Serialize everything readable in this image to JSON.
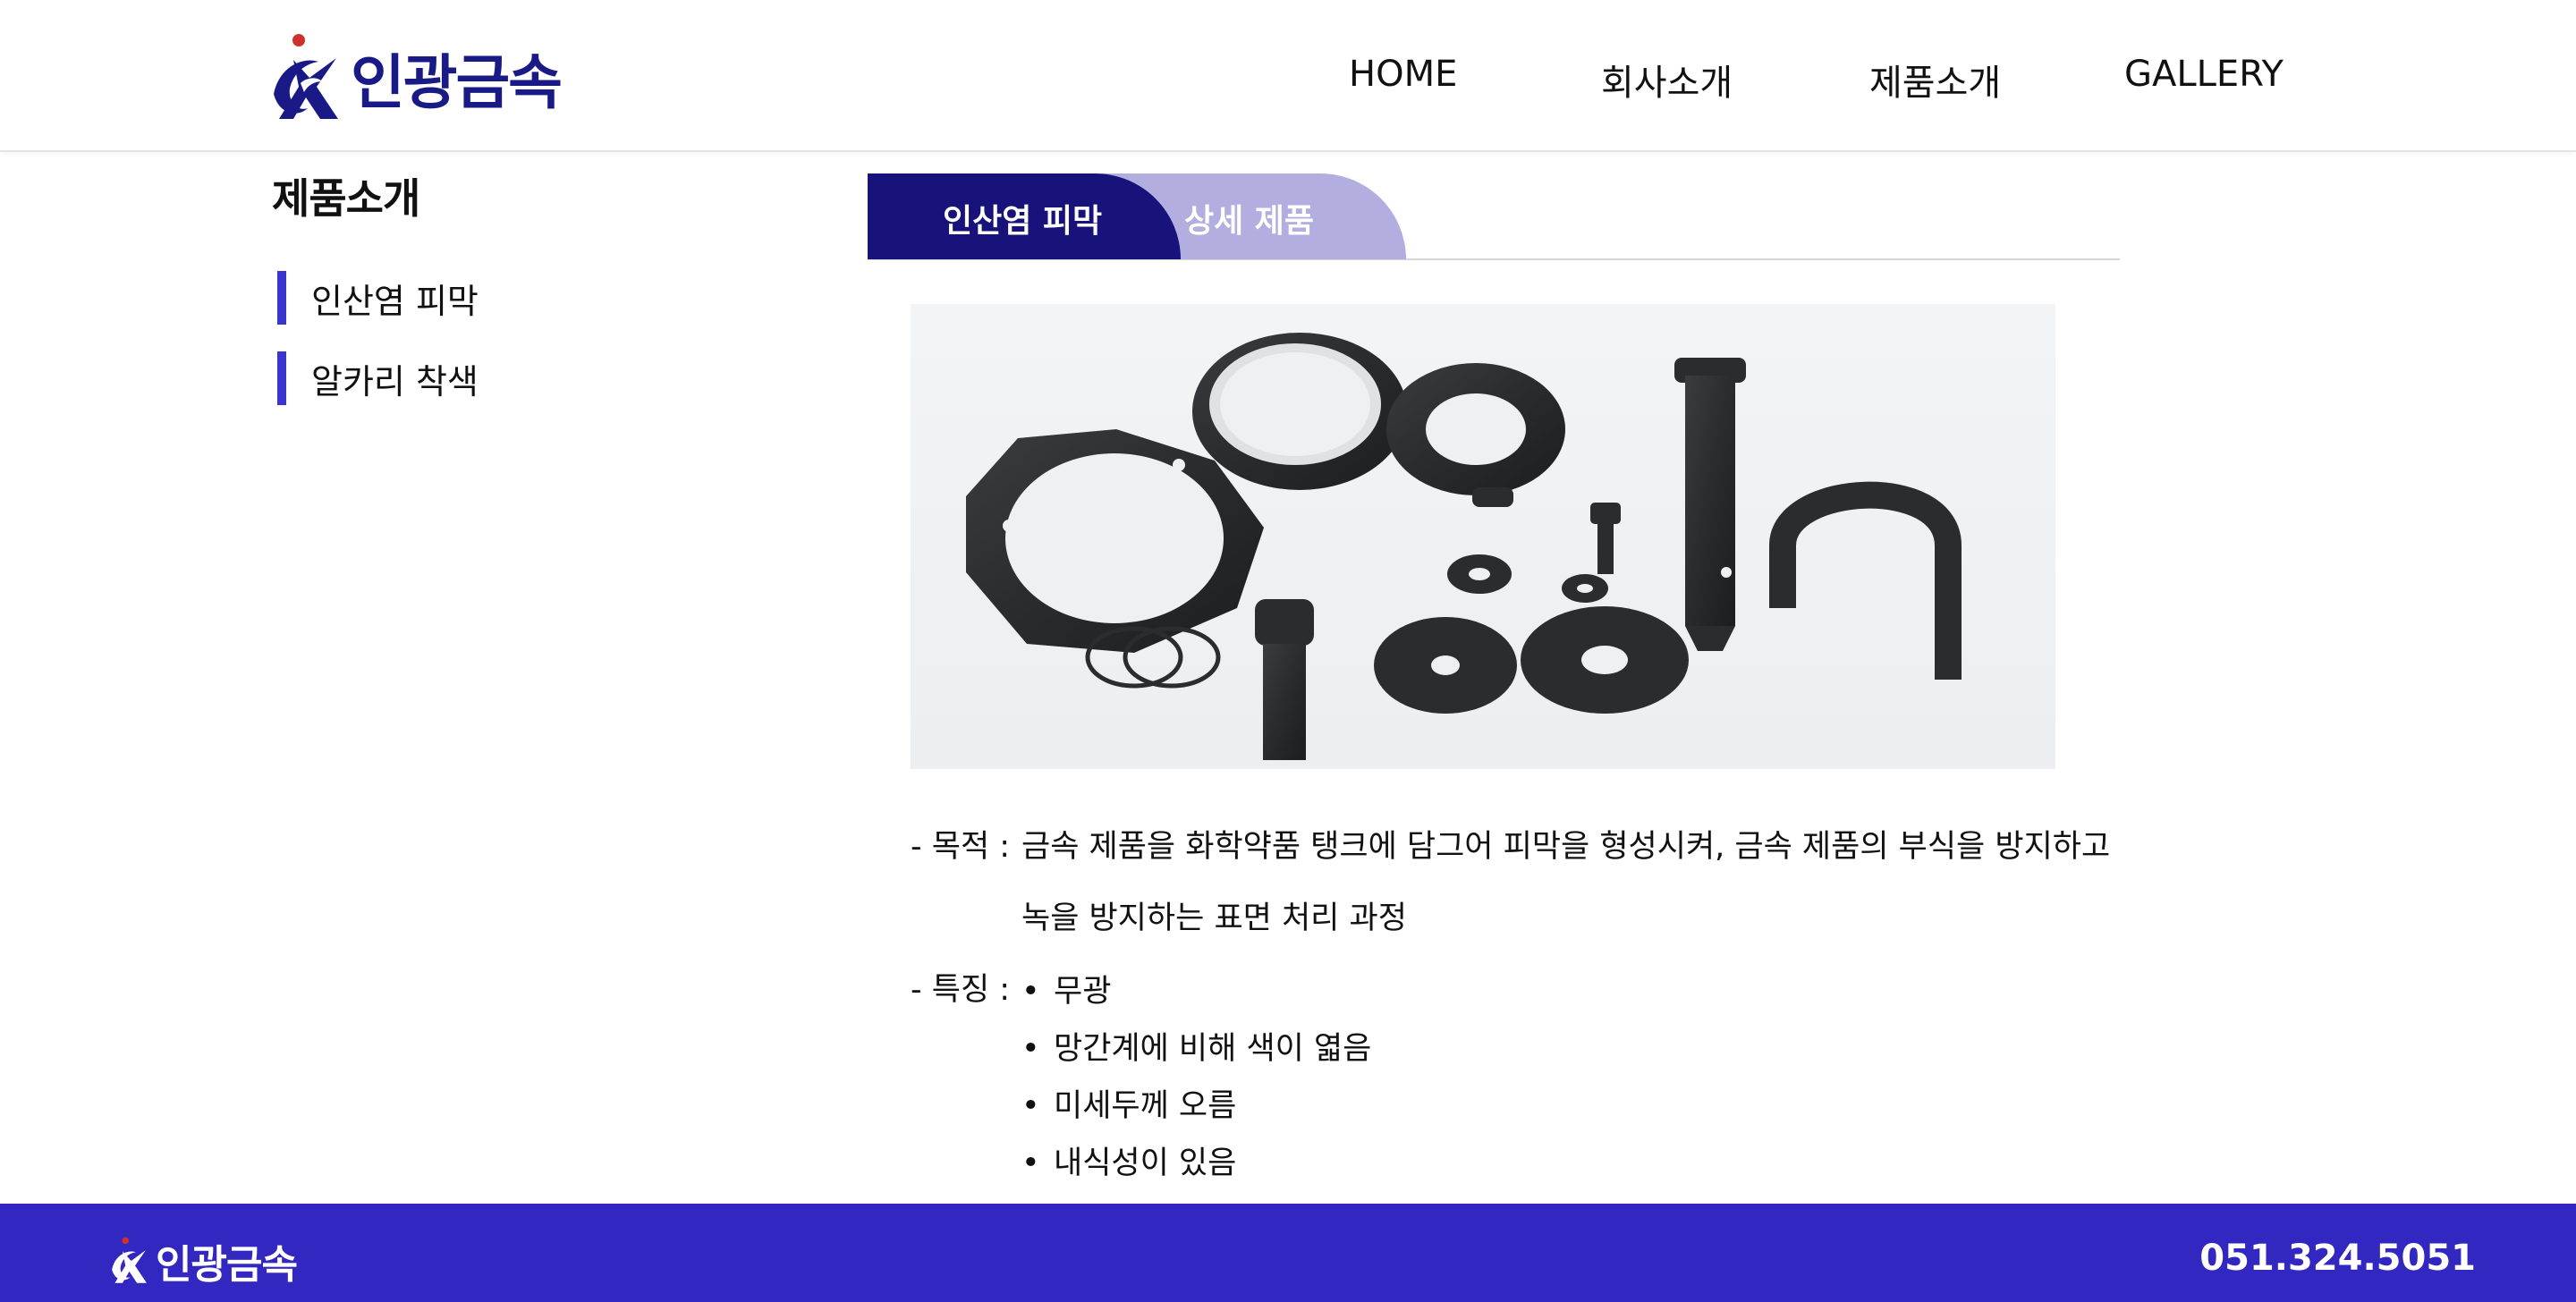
{
  "brand": {
    "name": "인광금속",
    "accent_navy": "#1a1a86",
    "accent_purple": "#3327c2",
    "logo_dot_color": "#d0302c"
  },
  "nav": {
    "items": [
      {
        "label": "HOME"
      },
      {
        "label": "회사소개"
      },
      {
        "label": "제품소개"
      },
      {
        "label": "GALLERY"
      }
    ]
  },
  "sidebar": {
    "title": "제품소개",
    "items": [
      {
        "label": "인산염 피막"
      },
      {
        "label": "알카리 착색"
      }
    ]
  },
  "tabs": {
    "active": "인산염 피막",
    "secondary": "상세 제품"
  },
  "content": {
    "purpose": {
      "label": "- 목적 :",
      "line1": "금속 제품을 화학약품 탱크에 담그어 피막을 형성시켜, 금속 제품의 부식을 방지하고",
      "line2": "녹을 방지하는 표면 처리 과정"
    },
    "features": {
      "label": "- 특징 :",
      "bullet_char": "•",
      "items": [
        "무광",
        "망간계에 비해 색이 엷음",
        "미세두께 오름",
        "내식성이 있음"
      ]
    }
  },
  "footer": {
    "brand": "인광금속",
    "phone": "051.324.5051"
  }
}
